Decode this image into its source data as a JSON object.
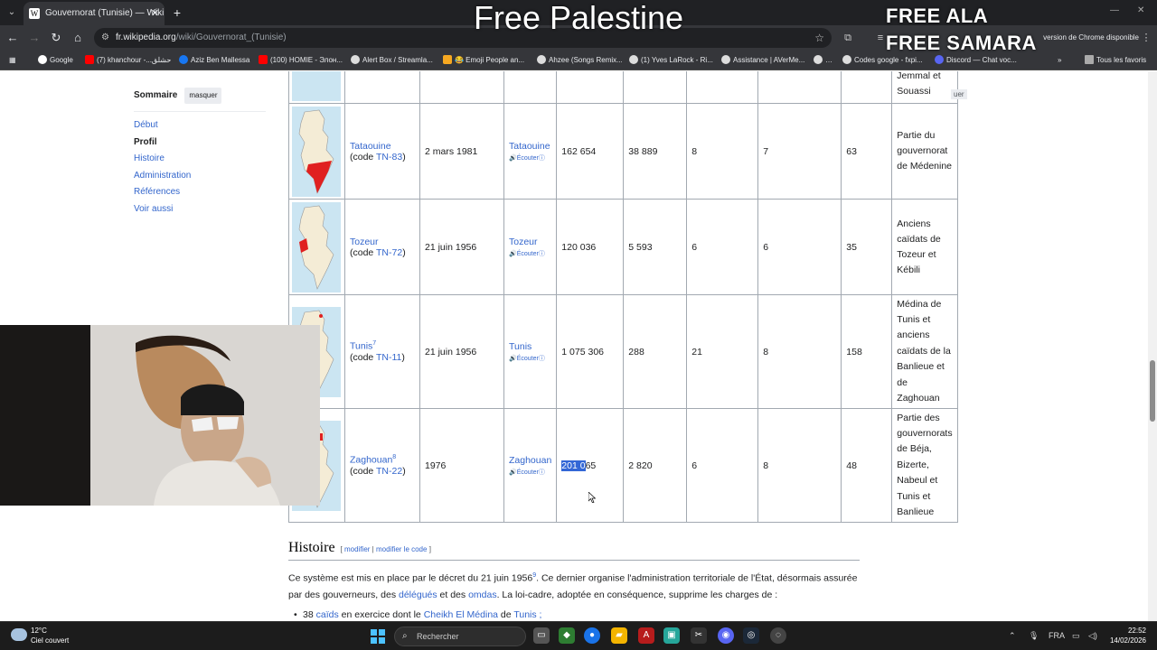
{
  "browser": {
    "tab_title": "Gouvernorat (Tunisie) — Wikipé",
    "url_host": "fr.wikipedia.org",
    "url_path": "/wiki/Gouvernorat_(Tunisie)",
    "update_label": "version de Chrome disponible",
    "bookmarks": [
      "Google",
      "(7) khanchour -...حشلق",
      "Aziz Ben Mallessa",
      "(100) HOMIE - Элон...",
      "Alert Box / Streamla...",
      "😂 Emoji People an...",
      "Ahzee (Songs Remix...",
      "(1) Yves LaRock - Ri...",
      "Assistance | AVerMe...",
      "Codes google - fxpi...",
      "Discord — Chat voc...",
      "Tous les favoris"
    ]
  },
  "overlay": {
    "title": "Free Palestine",
    "line1": "FREE ALA",
    "line2": "FREE SAMARA"
  },
  "toc": {
    "heading": "Sommaire",
    "hide_label": "masquer",
    "items": [
      "Début",
      "Profil",
      "Histoire",
      "Administration",
      "Références",
      "Voir aussi"
    ]
  },
  "table": {
    "partial_row": {
      "note_1": "Jemmal et",
      "note_2": "Souassi",
      "hide_stub": "uer"
    },
    "rows": [
      {
        "name": "Tataouine",
        "code_prefix": "(code ",
        "code": "TN-83",
        "code_suffix": ")",
        "date": "2 mars 1981",
        "seat": "Tataouine",
        "listen": "Écouter",
        "population": "162 654",
        "area": "38 889",
        "delegations": "8",
        "municipalities": "7",
        "imadas": "63",
        "origin": [
          "Partie du",
          "gouvernorat",
          "de Médenine"
        ]
      },
      {
        "name": "Tozeur",
        "code_prefix": "(code ",
        "code": "TN-72",
        "code_suffix": ")",
        "date": "21 juin 1956",
        "seat": "Tozeur",
        "listen": "Écouter",
        "population": "120 036",
        "area": "5 593",
        "delegations": "6",
        "municipalities": "6",
        "imadas": "35",
        "origin": [
          "Anciens",
          "caïdats de",
          "Tozeur et",
          "Kébili"
        ]
      },
      {
        "name": "Tunis",
        "note": "7",
        "code_prefix": "(code ",
        "code": "TN-11",
        "code_suffix": ")",
        "date": "21 juin 1956",
        "seat": "Tunis",
        "listen": "Écouter",
        "population": "1 075 306",
        "area": "288",
        "delegations": "21",
        "municipalities": "8",
        "imadas": "158",
        "origin": [
          "Médina de",
          "Tunis et",
          "anciens",
          "caïdats de la",
          "Banlieue et",
          "de",
          "Zaghouan"
        ]
      },
      {
        "name": "Zaghouan",
        "note": "8",
        "code_prefix": "(code ",
        "code": "TN-22",
        "code_suffix": ")",
        "date": "1976",
        "seat": "Zaghouan",
        "listen": "Écouter",
        "population_selected": "201 0",
        "population_rest": "65",
        "area": "2 820",
        "delegations": "6",
        "municipalities": "8",
        "imadas": "48",
        "origin": [
          "Partie des",
          "gouvernorats",
          "de Béja,",
          "Bizerte,",
          "Nabeul et",
          "Tunis et",
          "Banlieue"
        ]
      }
    ]
  },
  "history": {
    "heading": "Histoire",
    "edit_open": "[ ",
    "edit_1": "modifier",
    "edit_sep": " | ",
    "edit_2": "modifier le code",
    "edit_close": " ]",
    "p1_a": "Ce système est mis en place par le décret du 21 juin 1956",
    "p1_note": "9",
    "p1_b": ". Ce dernier organise l'administration territoriale de l'État, désormais assurée par des gouverneurs, des ",
    "p1_link1": "délégués",
    "p1_c": " et des ",
    "p1_link2": "omdas",
    "p1_d": ". La loi-cadre, adoptée en conséquence, supprime les charges de :",
    "bullet_a": "38 ",
    "bullet_link1": "caïds",
    "bullet_b": " en exercice dont le ",
    "bullet_link2": "Cheikh El Médina",
    "bullet_c": " de ",
    "bullet_link3": "Tunis ;"
  },
  "taskbar": {
    "temp": "12°C",
    "weather": "Ciel couvert",
    "search": "Rechercher",
    "lang": "FRA",
    "time": "22:52",
    "date": "14/02/2026"
  },
  "colors": {
    "link": "#3366cc",
    "selection": "#3367d6",
    "map_region": "#e02020"
  }
}
